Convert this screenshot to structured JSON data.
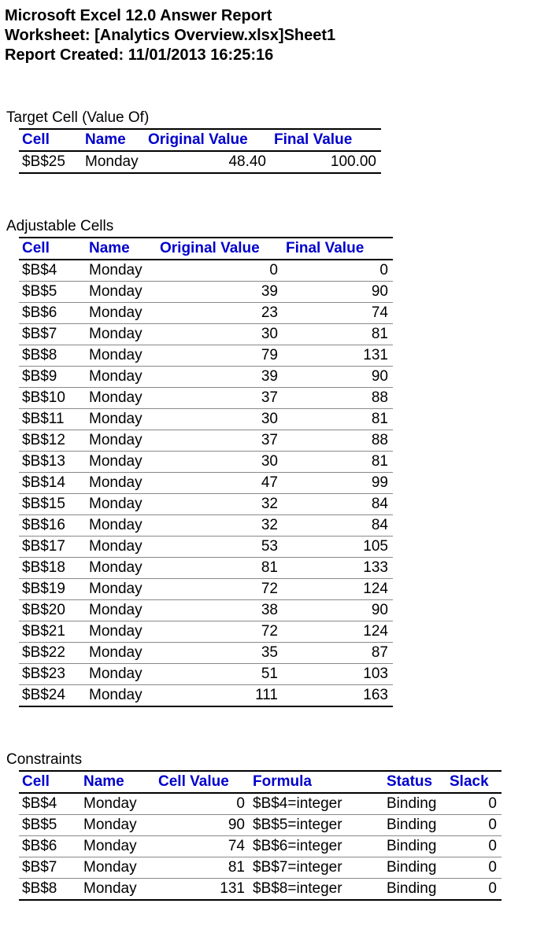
{
  "header": {
    "title": "Microsoft Excel 12.0 Answer Report",
    "worksheet": "Worksheet: [Analytics Overview.xlsx]Sheet1",
    "created": "Report Created: 11/01/2013 16:25:16"
  },
  "target_section": {
    "title": "Target Cell (Value Of)",
    "columns": {
      "cell": "Cell",
      "name": "Name",
      "original": "Original Value",
      "final": "Final Value"
    },
    "rows": [
      {
        "cell": "$B$25",
        "name": "Monday",
        "original": "48.40",
        "final": "100.00"
      }
    ]
  },
  "adjustable_section": {
    "title": "Adjustable Cells",
    "columns": {
      "cell": "Cell",
      "name": "Name",
      "original": "Original Value",
      "final": "Final Value"
    },
    "rows": [
      {
        "cell": "$B$4",
        "name": "Monday",
        "original": "0",
        "final": "0"
      },
      {
        "cell": "$B$5",
        "name": "Monday",
        "original": "39",
        "final": "90"
      },
      {
        "cell": "$B$6",
        "name": "Monday",
        "original": "23",
        "final": "74"
      },
      {
        "cell": "$B$7",
        "name": "Monday",
        "original": "30",
        "final": "81"
      },
      {
        "cell": "$B$8",
        "name": "Monday",
        "original": "79",
        "final": "131"
      },
      {
        "cell": "$B$9",
        "name": "Monday",
        "original": "39",
        "final": "90"
      },
      {
        "cell": "$B$10",
        "name": "Monday",
        "original": "37",
        "final": "88"
      },
      {
        "cell": "$B$11",
        "name": "Monday",
        "original": "30",
        "final": "81"
      },
      {
        "cell": "$B$12",
        "name": "Monday",
        "original": "37",
        "final": "88"
      },
      {
        "cell": "$B$13",
        "name": "Monday",
        "original": "30",
        "final": "81"
      },
      {
        "cell": "$B$14",
        "name": "Monday",
        "original": "47",
        "final": "99"
      },
      {
        "cell": "$B$15",
        "name": "Monday",
        "original": "32",
        "final": "84"
      },
      {
        "cell": "$B$16",
        "name": "Monday",
        "original": "32",
        "final": "84"
      },
      {
        "cell": "$B$17",
        "name": "Monday",
        "original": "53",
        "final": "105"
      },
      {
        "cell": "$B$18",
        "name": "Monday",
        "original": "81",
        "final": "133"
      },
      {
        "cell": "$B$19",
        "name": "Monday",
        "original": "72",
        "final": "124"
      },
      {
        "cell": "$B$20",
        "name": "Monday",
        "original": "38",
        "final": "90"
      },
      {
        "cell": "$B$21",
        "name": "Monday",
        "original": "72",
        "final": "124"
      },
      {
        "cell": "$B$22",
        "name": "Monday",
        "original": "35",
        "final": "87"
      },
      {
        "cell": "$B$23",
        "name": "Monday",
        "original": "51",
        "final": "103"
      },
      {
        "cell": "$B$24",
        "name": "Monday",
        "original": "111",
        "final": "163"
      }
    ]
  },
  "constraints_section": {
    "title": "Constraints",
    "columns": {
      "cell": "Cell",
      "name": "Name",
      "value": "Cell Value",
      "formula": "Formula",
      "status": "Status",
      "slack": "Slack"
    },
    "rows": [
      {
        "cell": "$B$4",
        "name": "Monday",
        "value": "0",
        "formula": "$B$4=integer",
        "status": "Binding",
        "slack": "0"
      },
      {
        "cell": "$B$5",
        "name": "Monday",
        "value": "90",
        "formula": "$B$5=integer",
        "status": "Binding",
        "slack": "0"
      },
      {
        "cell": "$B$6",
        "name": "Monday",
        "value": "74",
        "formula": "$B$6=integer",
        "status": "Binding",
        "slack": "0"
      },
      {
        "cell": "$B$7",
        "name": "Monday",
        "value": "81",
        "formula": "$B$7=integer",
        "status": "Binding",
        "slack": "0"
      },
      {
        "cell": "$B$8",
        "name": "Monday",
        "value": "131",
        "formula": "$B$8=integer",
        "status": "Binding",
        "slack": "0"
      }
    ]
  }
}
